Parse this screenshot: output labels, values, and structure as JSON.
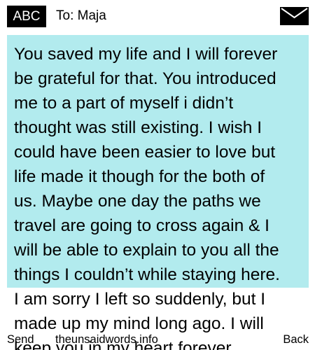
{
  "header": {
    "input_mode": "ABC",
    "to_label": "To: Maja",
    "icon": "envelope-icon"
  },
  "message": {
    "highlight_color": "#b2ebee",
    "lines": [
      "You saved my life and I will forever",
      "be grateful for that. You introduced",
      "me to a part of myself i didn’t",
      "thought was still existing. I wish I",
      "could have been easier to love but",
      "life made it though for the both of",
      "us. Maybe one day the paths we",
      "travel are going to cross again & I",
      "will be able to explain to you all the",
      "things I couldn’t while staying here.",
      "I am sorry I left so suddenly, but I",
      "made up my mind long ago. I will",
      "keep you in my heart forever"
    ]
  },
  "softkeys": {
    "left": "Send",
    "middle": "theunsaidwords.info",
    "right": "Back"
  }
}
